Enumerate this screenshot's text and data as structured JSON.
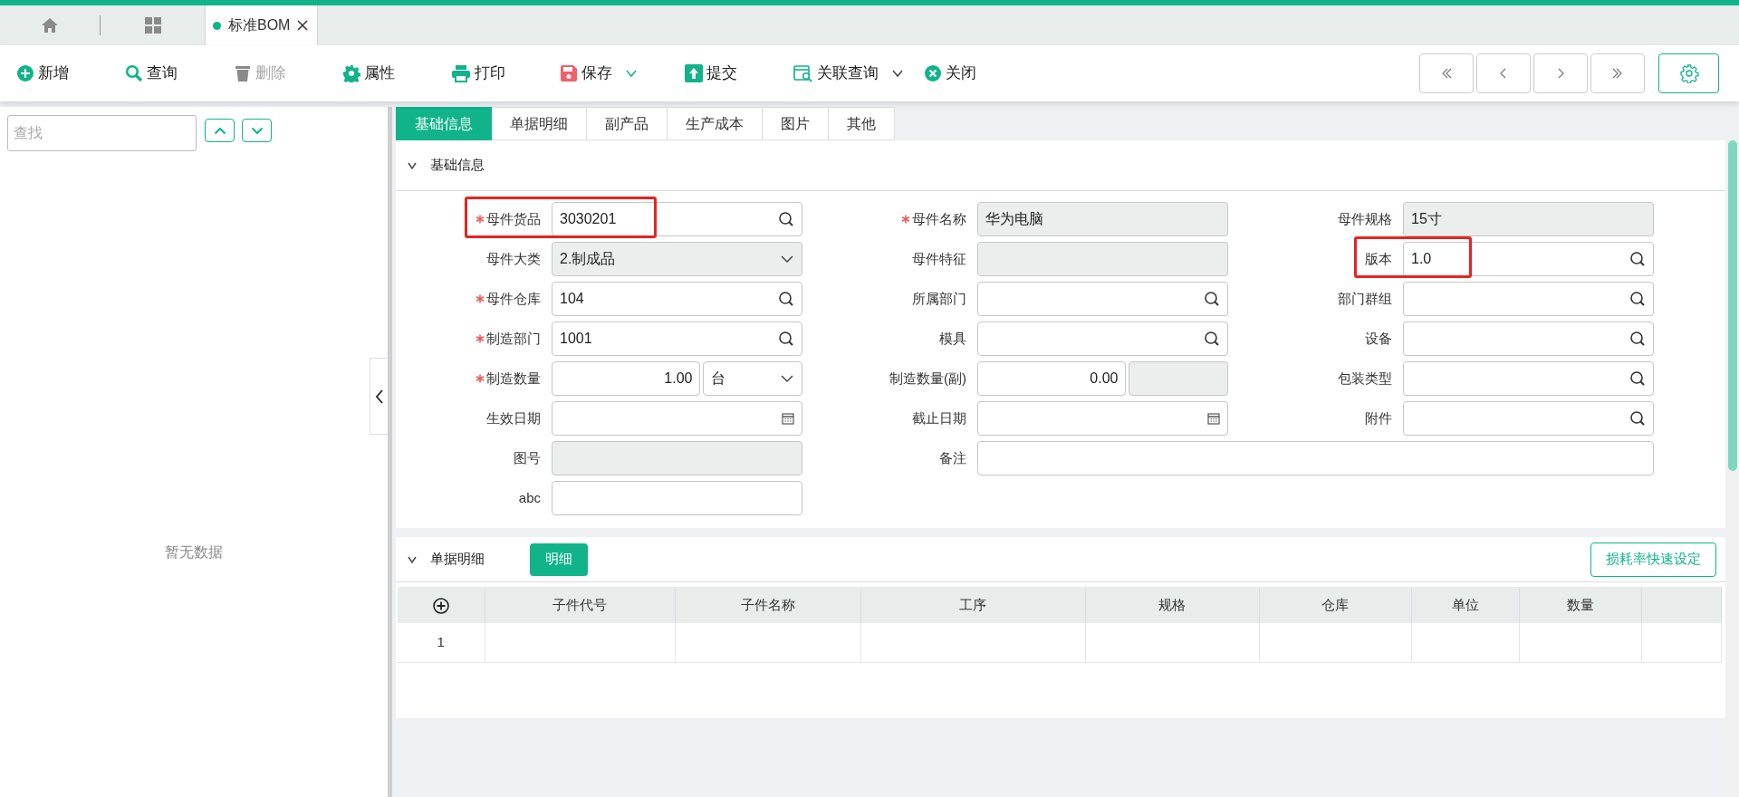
{
  "document_tabs": [
    {
      "label": "标准BOM",
      "selected": true
    }
  ],
  "toolbar": [
    {
      "label": "新增",
      "disabled": false,
      "dropdown": false
    },
    {
      "label": "查询",
      "disabled": false,
      "dropdown": false
    },
    {
      "label": "删除",
      "disabled": true,
      "dropdown": false
    },
    {
      "label": "属性",
      "disabled": false,
      "dropdown": false
    },
    {
      "label": "打印",
      "disabled": false,
      "dropdown": false
    },
    {
      "label": "保存",
      "disabled": false,
      "dropdown": true
    },
    {
      "label": "提交",
      "disabled": false,
      "dropdown": false
    },
    {
      "label": "关联查询",
      "disabled": false,
      "dropdown": true
    },
    {
      "label": "关闭",
      "disabled": false,
      "dropdown": false
    }
  ],
  "left_panel": {
    "search_placeholder": "查找",
    "empty_text": "暂无数据"
  },
  "detail_tabs": [
    {
      "label": "基础信息",
      "selected": true
    },
    {
      "label": "单据明细",
      "selected": false
    },
    {
      "label": "副产品",
      "selected": false
    },
    {
      "label": "生产成本",
      "selected": false
    },
    {
      "label": "图片",
      "selected": false
    },
    {
      "label": "其他",
      "selected": false
    }
  ],
  "basic_section": {
    "title": "基础信息",
    "expanded": true
  },
  "form": {
    "rows": [
      [
        {
          "label": "母件货品",
          "required": true,
          "kind": "search",
          "value": "3030201",
          "disabled": false,
          "highlighted": true
        },
        {
          "label": "母件名称",
          "required": true,
          "kind": "plain",
          "value": "华为电脑",
          "disabled": true,
          "highlighted": false
        },
        {
          "label": "母件规格",
          "required": false,
          "kind": "plain",
          "value": "15寸",
          "disabled": true,
          "highlighted": false
        }
      ],
      [
        {
          "label": "母件大类",
          "required": false,
          "kind": "select",
          "value": "2.制成品",
          "disabled": true,
          "highlighted": false
        },
        {
          "label": "母件特征",
          "required": false,
          "kind": "plain",
          "disabled": true,
          "highlighted": false
        },
        {
          "label": "版本",
          "required": false,
          "kind": "search",
          "value": "1.0",
          "disabled": false,
          "highlighted": true
        }
      ],
      [
        {
          "label": "母件仓库",
          "required": true,
          "kind": "search",
          "value": "104",
          "disabled": false,
          "highlighted": false
        },
        {
          "label": "所属部门",
          "required": false,
          "kind": "search",
          "disabled": false,
          "highlighted": false
        },
        {
          "label": "部门群组",
          "required": false,
          "kind": "search",
          "disabled": false,
          "highlighted": false
        }
      ],
      [
        {
          "label": "制造部门",
          "required": true,
          "kind": "search",
          "value": "1001",
          "disabled": false,
          "highlighted": false
        },
        {
          "label": "模具",
          "required": false,
          "kind": "search",
          "disabled": false,
          "highlighted": false
        },
        {
          "label": "设备",
          "required": false,
          "kind": "search",
          "disabled": false,
          "highlighted": false
        }
      ],
      [
        {
          "label": "制造数量",
          "required": true,
          "kind": "quantity",
          "value": "1.00",
          "unit": "台",
          "unit_disabled": false,
          "disabled": false,
          "highlighted": false
        },
        {
          "label": "制造数量(副)",
          "required": false,
          "kind": "quantity",
          "value": "0.00",
          "unit_disabled": true,
          "disabled": false,
          "highlighted": false
        },
        {
          "label": "包装类型",
          "required": false,
          "kind": "search",
          "disabled": false,
          "highlighted": false
        }
      ],
      [
        {
          "label": "生效日期",
          "required": false,
          "kind": "date",
          "disabled": false,
          "highlighted": false
        },
        {
          "label": "截止日期",
          "required": false,
          "kind": "date",
          "disabled": false,
          "highlighted": false
        },
        {
          "label": "附件",
          "required": false,
          "kind": "search",
          "disabled": false,
          "highlighted": false
        }
      ],
      [
        {
          "label": "图号",
          "required": false,
          "kind": "plain",
          "disabled": true,
          "highlighted": false
        },
        {
          "label": "备注",
          "required": false,
          "kind": "plain",
          "disabled": false,
          "highlighted": false
        }
      ],
      [
        {
          "label": "abc",
          "required": false,
          "kind": "plain",
          "disabled": false,
          "highlighted": false
        }
      ]
    ]
  },
  "detail_section": {
    "title": "单据明细",
    "expanded": true,
    "toggle_button": "明细",
    "action_button": "损耗率快速设定"
  },
  "table": {
    "columns": [
      "子件代号",
      "子件名称",
      "工序",
      "规格",
      "仓库",
      "单位",
      "数量"
    ],
    "rows": [
      {
        "number": "1"
      }
    ]
  }
}
